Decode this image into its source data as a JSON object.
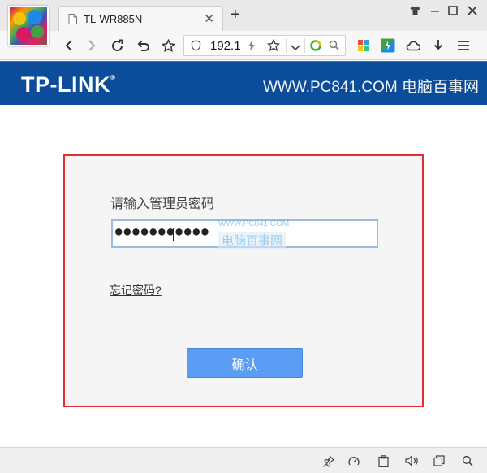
{
  "browser": {
    "tab_title": "TL-WR885N",
    "new_tab_label": "+",
    "address": "192.1",
    "window_controls": [
      "shirt-icon",
      "minimize-icon",
      "maximize-icon",
      "close-icon"
    ],
    "toolbar_icons": [
      "back-icon",
      "forward-icon",
      "reload-icon",
      "undo-icon",
      "star-icon",
      "shield-icon",
      "lightning-icon",
      "bookmark-star-icon",
      "dropdown-icon",
      "search-engine-icon",
      "search-icon",
      "apps-grid-icon",
      "colorful-app-icon",
      "cloud-icon",
      "download-icon",
      "menu-icon"
    ],
    "status_icons": [
      "pin-icon",
      "speedup-icon",
      "clipboard-icon",
      "volume-icon",
      "window-icon",
      "zoom-icon"
    ]
  },
  "header": {
    "brand": "TP-LINK",
    "brand_mark": "®",
    "watermark": "WWW.PC841.COM 电脑百事网"
  },
  "login": {
    "prompt": "请输入管理员密码",
    "password_masked": "●●●●●●●●●●●",
    "field_watermark_site": "WWW.PC841.COM",
    "field_watermark_name": "电脑百事网",
    "forgot_link": "忘记密码?",
    "confirm_button": "确认"
  },
  "colors": {
    "banner": "#0b4d9a",
    "highlight_border": "#e02f35",
    "confirm_button": "#5b9cf4"
  }
}
